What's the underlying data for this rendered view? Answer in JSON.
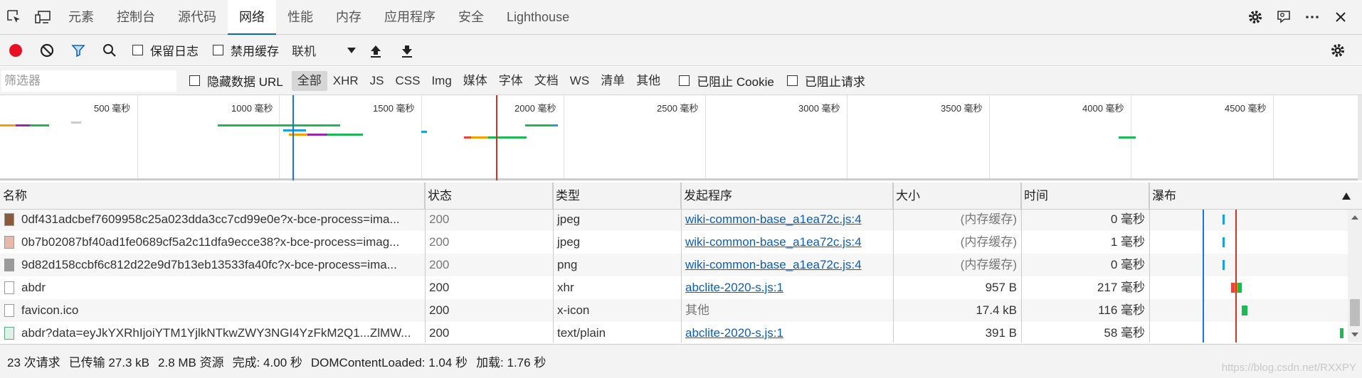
{
  "tabs": {
    "items": [
      "元素",
      "控制台",
      "源代码",
      "网络",
      "性能",
      "内存",
      "应用程序",
      "安全",
      "Lighthouse"
    ],
    "active": "网络"
  },
  "toolbar": {
    "preserve_log": "保留日志",
    "disable_cache": "禁用缓存",
    "throttle": "联机"
  },
  "filter": {
    "placeholder": "筛选器",
    "hide_data_urls": "隐藏数据 URL",
    "types": [
      "全部",
      "XHR",
      "JS",
      "CSS",
      "Img",
      "媒体",
      "字体",
      "文档",
      "WS",
      "清单",
      "其他"
    ],
    "blocked_cookies": "已阻止 Cookie",
    "blocked_requests": "已阻止请求"
  },
  "overview": {
    "ticks": [
      "500 毫秒",
      "1000 毫秒",
      "1500 毫秒",
      "2000 毫秒",
      "2500 毫秒",
      "3000 毫秒",
      "3500 毫秒",
      "4000 毫秒",
      "4500 毫秒"
    ],
    "dcl_ms": 1040,
    "load_ms": 1760
  },
  "table": {
    "columns": [
      "名称",
      "状态",
      "类型",
      "发起程序",
      "大小",
      "时间",
      "瀑布"
    ],
    "rows": [
      {
        "name": "0df431adcbef7609958c25a023dda3cc7cd99e0e?x-bce-process=ima...",
        "status": "200",
        "type": "jpeg",
        "initiator": "wiki-common-base_a1ea72c.js:4",
        "size": "(内存缓存)",
        "time": "0 毫秒"
      },
      {
        "name": "0b7b02087bf40ad1fe0689cf5a2c11dfa9ecce38?x-bce-process=imag...",
        "status": "200",
        "type": "jpeg",
        "initiator": "wiki-common-base_a1ea72c.js:4",
        "size": "(内存缓存)",
        "time": "1 毫秒"
      },
      {
        "name": "9d82d158ccbf6c812d22e9d7b13eb13533fa40fc?x-bce-process=ima...",
        "status": "200",
        "type": "png",
        "initiator": "wiki-common-base_a1ea72c.js:4",
        "size": "(内存缓存)",
        "time": "0 毫秒"
      },
      {
        "name": "abdr",
        "status": "200",
        "type": "xhr",
        "initiator": "abclite-2020-s.js:1",
        "size": "957 B",
        "time": "217 毫秒"
      },
      {
        "name": "favicon.ico",
        "status": "200",
        "type": "x-icon",
        "initiator": "其他",
        "size": "17.4 kB",
        "time": "116 毫秒"
      },
      {
        "name": "abdr?data=eyJkYXRhIjoiYTM1YjlkNTkwZWY3NGI4YzFkM2Q1...ZlMW...",
        "status": "200",
        "type": "text/plain",
        "initiator": "abclite-2020-s.js:1",
        "size": "391 B",
        "time": "58 毫秒"
      }
    ]
  },
  "status": {
    "requests": "23 次请求",
    "transferred": "已传输 27.3 kB",
    "resources": "2.8 MB 资源",
    "finish": "完成: 4.00 秒",
    "dcl": "DOMContentLoaded: 1.04 秒",
    "load": "加载: 1.76 秒"
  },
  "watermark": "https://blog.csdn.net/RXXPY",
  "colors": {
    "record": "#e81123",
    "accent": "#0a66c2",
    "dcl_line": "#1a73e8",
    "load_line": "#d93025"
  }
}
